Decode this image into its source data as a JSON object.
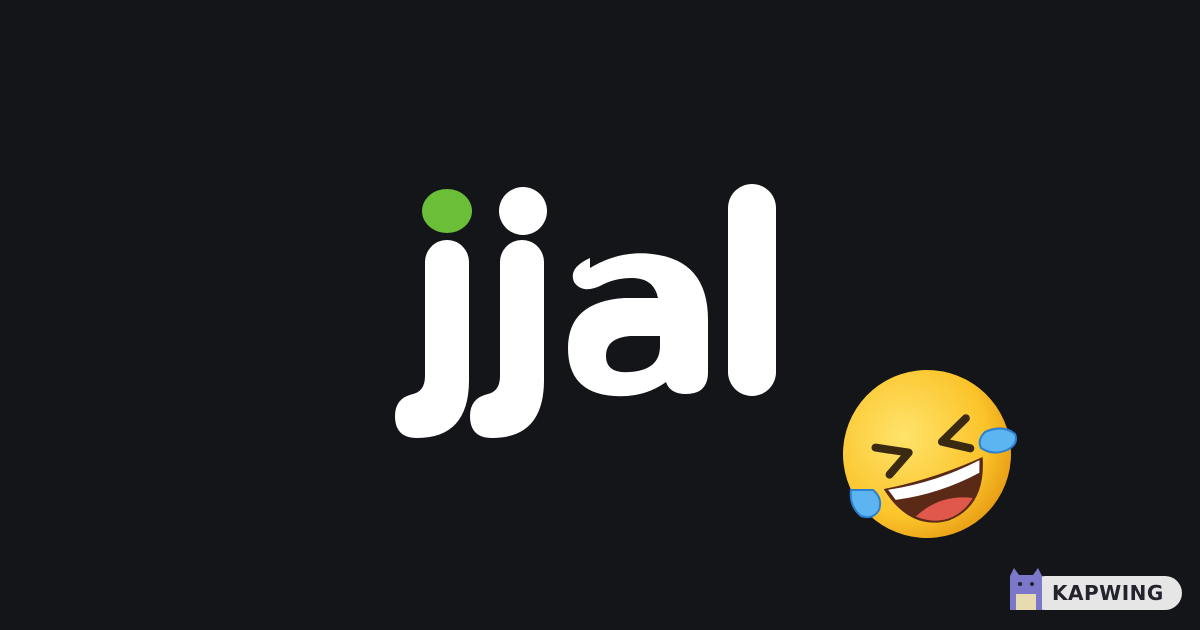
{
  "logo": {
    "wordmark": "jjal",
    "dot_color": "#6bbe37",
    "letter_color": "#ffffff"
  },
  "emoji": {
    "icon": "rolling-on-the-floor-laughing-emoji"
  },
  "watermark": {
    "label": "KAPWING",
    "icon": "kapwing-mascot-icon"
  },
  "colors": {
    "background": "#141519",
    "badge": "#e6e6e6",
    "badge_text": "#23232d"
  }
}
